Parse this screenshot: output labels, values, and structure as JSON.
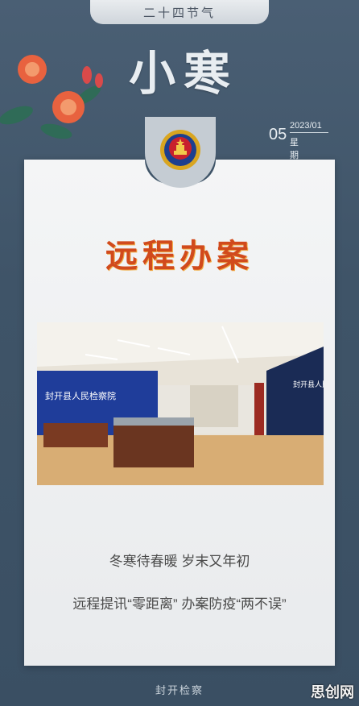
{
  "header": {
    "tab_text": "二十四节气",
    "title": "小寒"
  },
  "date": {
    "day": "05",
    "year_month": "2023/01",
    "weekday": "星期四"
  },
  "colors": {
    "background": "#3f5468",
    "headline": "#d14a1c",
    "card": "#f0f1f2"
  },
  "headline": "远程办案",
  "photo": {
    "sign_left": "封开县人民检察院",
    "sign_right": "封开县人民"
  },
  "captions": [
    "冬寒待春暖  岁末又年初",
    "远程提讯“零距离”  办案防疫“两不误”"
  ],
  "footer": "封开检察",
  "watermark": "思创网"
}
